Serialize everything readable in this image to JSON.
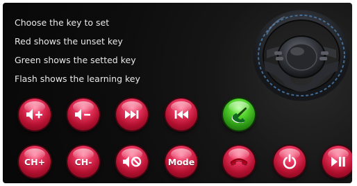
{
  "instructions": {
    "line1": "Choose the key to set",
    "line2": "Red shows the unset key",
    "line3": "Green shows the setted key",
    "line4": "Flash shows the learning key"
  },
  "buttons": {
    "vol_up": {
      "icon": "volume-up-icon",
      "state": "unset"
    },
    "vol_down": {
      "icon": "volume-down-icon",
      "state": "unset"
    },
    "next": {
      "icon": "next-track-icon",
      "state": "unset"
    },
    "prev": {
      "icon": "previous-track-icon",
      "state": "unset"
    },
    "call_answer": {
      "icon": "phone-answer-icon",
      "state": "set"
    },
    "ch_up": {
      "label": "CH+",
      "state": "unset"
    },
    "ch_down": {
      "label": "CH-",
      "state": "unset"
    },
    "mute": {
      "icon": "mute-icon",
      "state": "unset"
    },
    "mode": {
      "label": "Mode",
      "state": "unset"
    },
    "call_hangup": {
      "icon": "phone-hangup-icon",
      "state": "unset"
    },
    "power": {
      "icon": "power-icon",
      "state": "unset"
    },
    "play_pause": {
      "icon": "play-pause-icon",
      "state": "unset"
    }
  },
  "colors": {
    "unset": "#c8143c",
    "set": "#3fbf1f",
    "background": "#111111"
  }
}
